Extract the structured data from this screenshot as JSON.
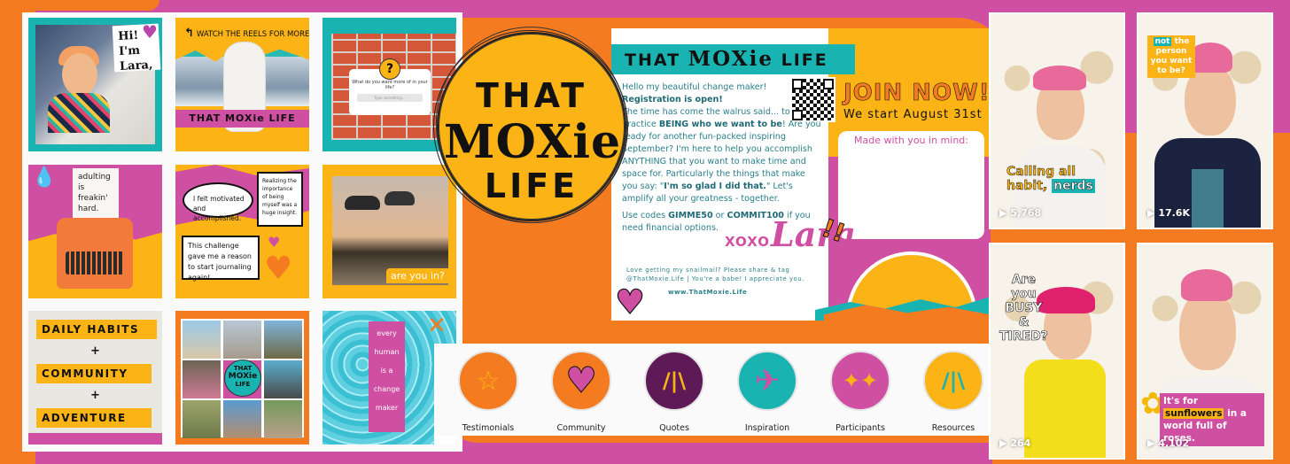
{
  "colors": {
    "orange": "#f47b20",
    "pink": "#cf4fa2",
    "teal": "#19b3b1",
    "yellow": "#fbb316",
    "purple": "#5e1a56"
  },
  "grid": {
    "tiles": [
      {
        "id": "hi-lara",
        "text": "Hi! I'm Lara,"
      },
      {
        "id": "watch-reels",
        "text": "WATCH THE REELS FOR MORE",
        "band": "THAT MOXie LIFE"
      },
      {
        "id": "question",
        "question": "What do you want more of in your life?",
        "placeholder": "Type something..."
      },
      {
        "id": "adulting",
        "lines": [
          "adulting",
          "is",
          "freakin'",
          "hard."
        ]
      },
      {
        "id": "testimonials",
        "bubbles": [
          "I felt motivated and accomplished.",
          "Realizing the importance of being myself was a huge insight.",
          "This challenge gave me a reason to start journaling again!"
        ]
      },
      {
        "id": "are-you-in",
        "text": "are you in?"
      },
      {
        "id": "habits",
        "lines": [
          "DAILY HABITS",
          "+",
          "COMMUNITY",
          "+",
          "ADVENTURE"
        ]
      },
      {
        "id": "collage",
        "logo": [
          "THAT",
          "MOXie",
          "LIFE"
        ]
      },
      {
        "id": "change-maker",
        "lines": [
          "every",
          "human",
          "is a",
          "change",
          "maker"
        ]
      }
    ]
  },
  "logo": {
    "line1": "THAT",
    "line2": "MOXie",
    "line3": "LIFE"
  },
  "postcard": {
    "banner_a": "THAT ",
    "banner_b": "MOXie",
    "banner_c": " LIFE",
    "greeting": "Hello my beautiful change maker!",
    "registration": "Registration is open!",
    "body1": "The time has come the walrus said... to practice ",
    "body1_bold": "BEING who we want to be",
    "body2": "! Are you ready for another fun-packed inspiring September? I'm here to help you accomplish ANYTHING that you want to make time and space for. Particularly the things that make you say: \"",
    "body2_bold": "I'm so glad I did that.",
    "body3": "\" Let's amplify all your greatness - together.",
    "codes_pre": "Use codes ",
    "code1": "GIMME50",
    "codes_or": " or ",
    "code2": "COMMIT100",
    "codes_post": " if you need financial options.",
    "xoxo": "XOXO",
    "signature": "Lara",
    "snailmail": "Love getting my snailmail? Please share & tag @ThatMoxie.Life | You're a babe! I appreciate you.",
    "website": "www.ThatMoxie.Life",
    "join": "JOIN NOW!",
    "start": "We start August 31st",
    "made": "Made with you in mind:"
  },
  "highlights": [
    {
      "label": "Testimonials",
      "icon": "star-icon",
      "glyph": "☆",
      "bg": "#f47b20",
      "fg": "#fbb316"
    },
    {
      "label": "Community",
      "icon": "heart-icon",
      "glyph": "♥",
      "bg": "#f47b20",
      "fg": "#cf4fa2"
    },
    {
      "label": "Quotes",
      "icon": "burst-icon",
      "glyph": "/|\\",
      "bg": "#5e1a56",
      "fg": "#fbb316"
    },
    {
      "label": "Inspiration",
      "icon": "paper-plane-icon",
      "glyph": "✈",
      "bg": "#19b3b1",
      "fg": "#cf4fa2"
    },
    {
      "label": "Participants",
      "icon": "sparkle-icon",
      "glyph": "✦✦",
      "bg": "#cf4fa2",
      "fg": "#fbb316"
    },
    {
      "label": "Resources",
      "icon": "burst-icon",
      "glyph": "/|\\",
      "bg": "#fbb316",
      "fg": "#19b3b1"
    }
  ],
  "reels": [
    {
      "caption_a": "Calling all",
      "caption_b": "habit, ",
      "caption_tag": "nerds",
      "views": "5,768"
    },
    {
      "caption_tag": "not",
      "caption_a": " the person you want to be?",
      "views": "17.6K"
    },
    {
      "caption_lines": [
        "Are",
        "you",
        "BUSY",
        "&",
        "TIRED?"
      ],
      "views": "264"
    },
    {
      "caption_a": "It's for ",
      "caption_hi": "sunflowers",
      "caption_b": " in a world full of roses.",
      "views": "4,102"
    }
  ]
}
